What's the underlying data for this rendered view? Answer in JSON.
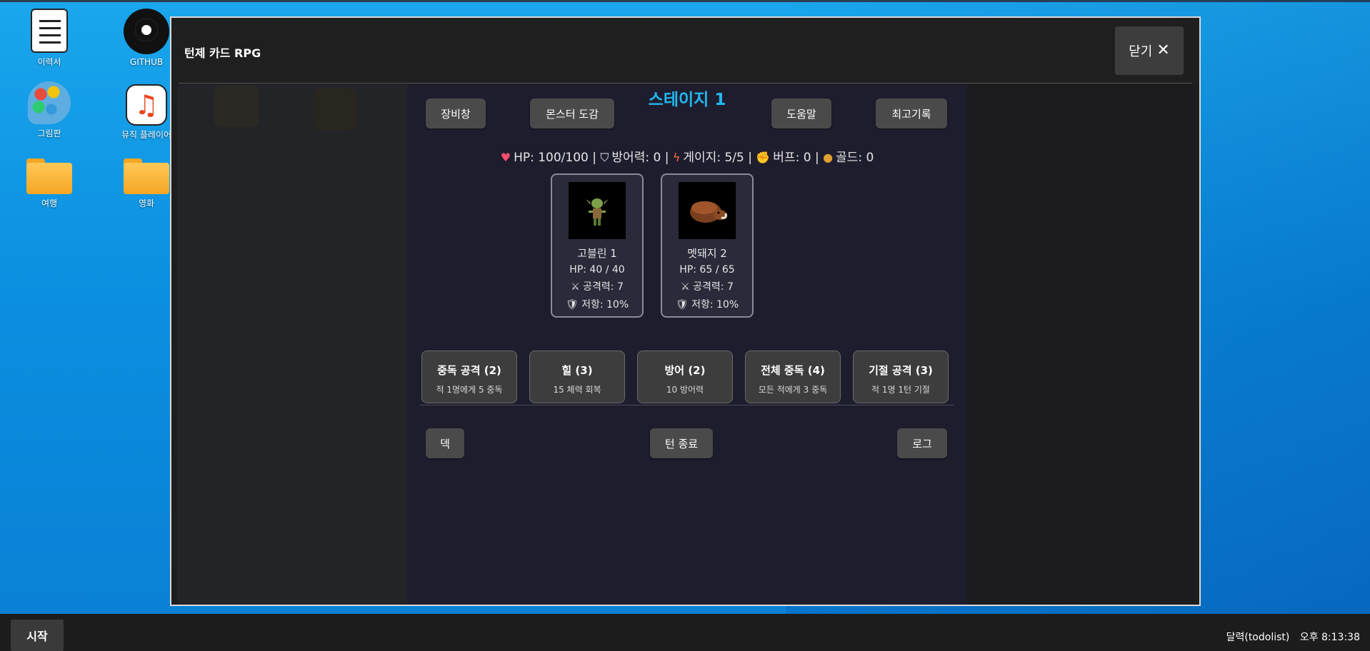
{
  "desktop": {
    "icons": [
      {
        "label": "이력서",
        "icon": "resume-doc-icon"
      },
      {
        "label": "GITHUB",
        "icon": "github-icon"
      },
      {
        "label": "그림판",
        "icon": "paint-palette-icon"
      },
      {
        "label": "뮤직 플레이어",
        "icon": "music-note-icon"
      },
      {
        "label": "여행",
        "icon": "folder-icon"
      },
      {
        "label": "영화",
        "icon": "folder-icon"
      }
    ]
  },
  "window": {
    "title": "턴제 카드 RPG",
    "close_label": "닫기",
    "close_icon": "close-x-icon"
  },
  "game": {
    "stage_title": "스테이지 1",
    "top_buttons": {
      "equipment": "장비창",
      "monster_book": "몬스터 도감",
      "help": "도움말",
      "records": "최고기록"
    },
    "status": {
      "hp": "HP: 100/100",
      "defense": "방어력: 0",
      "gauge": "게이지: 5/5",
      "buff": "버프: 0",
      "gold": "골드: 0",
      "icons": [
        "heart-icon",
        "shield-icon",
        "lightning-icon",
        "muscle-icon",
        "money-bag-icon"
      ]
    },
    "monsters": [
      {
        "name": "고블린 1",
        "hp": "HP: 40 / 40",
        "attack": "⚔ 공격력: 7",
        "resist": "🛡 저항: 10%",
        "sprite": "goblin-sprite"
      },
      {
        "name": "멧돼지 2",
        "hp": "HP: 65 / 65",
        "attack": "⚔ 공격력: 7",
        "resist": "🛡 저항: 10%",
        "sprite": "boar-sprite"
      }
    ],
    "cards": [
      {
        "name": "중독 공격 (2)",
        "desc": "적 1명에게 5 중독"
      },
      {
        "name": "힐 (3)",
        "desc": "15 체력 회복"
      },
      {
        "name": "방어 (2)",
        "desc": "10 방어력"
      },
      {
        "name": "전체 중독 (4)",
        "desc": "모든 적에게 3 중독"
      },
      {
        "name": "기절 공격 (3)",
        "desc": "적 1명 1턴 기절"
      }
    ],
    "bottom_buttons": {
      "deck": "덱",
      "end_turn": "턴 종료",
      "log": "로그"
    }
  },
  "taskbar": {
    "start_label": "시작",
    "tray_text": "달력(todolist)",
    "clock": "오후 8:13:38"
  }
}
